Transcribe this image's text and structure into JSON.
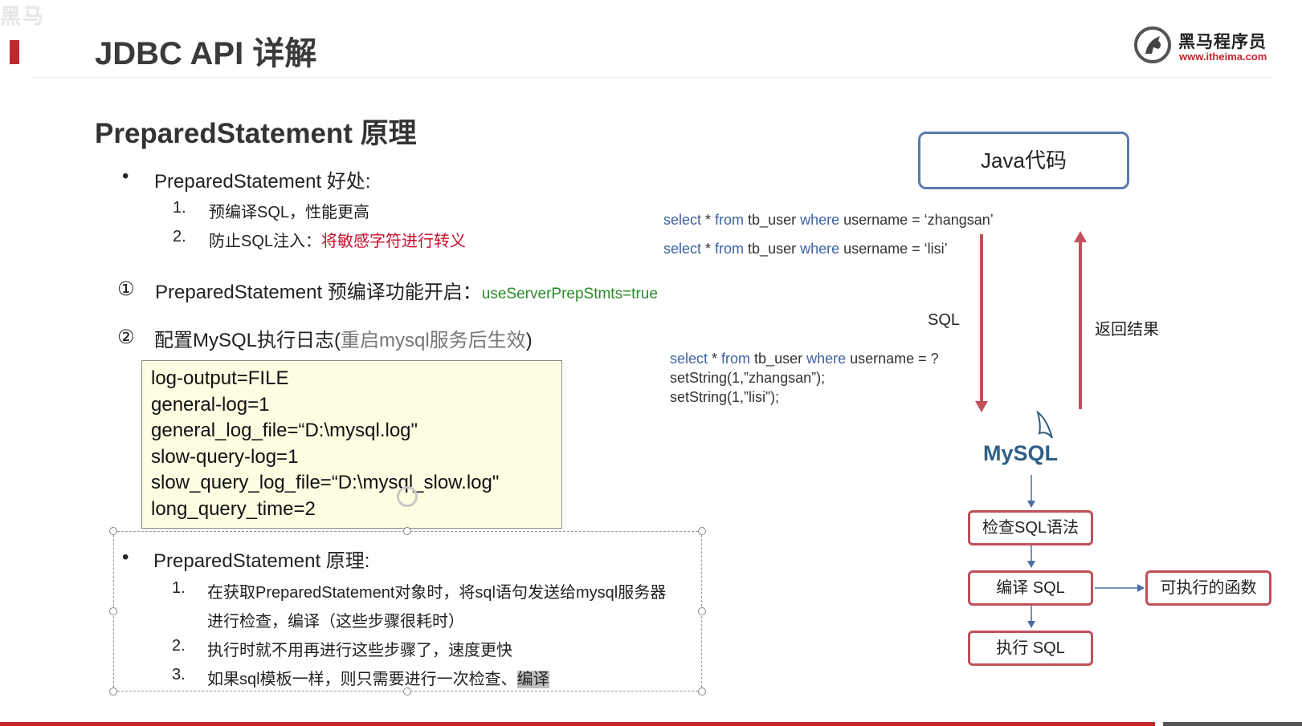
{
  "header": {
    "corner_watermark": "黑马",
    "title": "JDBC API 详解",
    "logo": {
      "name": "黑马程序员",
      "url": "www.itheima.com",
      "icon": "horse-head-logo"
    }
  },
  "section": {
    "title": "PreparedStatement 原理",
    "benefits": {
      "bullet": "PreparedStatement 好处:",
      "items": [
        {
          "num": "1.",
          "text": "预编译SQL，性能更高"
        },
        {
          "num": "2.",
          "text": "防止SQL注入：",
          "highlight": "将敏感字符进行转义"
        }
      ]
    },
    "step1": {
      "marker": "①",
      "text": "PreparedStatement 预编译功能开启：",
      "value": "useServerPrepStmts=true"
    },
    "step2": {
      "marker": "②",
      "text": "配置MySQL执行日志(",
      "note": "重启mysql服务后生效",
      "close": ")"
    },
    "config_lines": [
      "log-output=FILE",
      "general-log=1",
      "general_log_file=“D:\\mysql.log\"",
      "slow-query-log=1",
      "slow_query_log_file=“D:\\mysql_slow.log\"",
      "long_query_time=2"
    ],
    "principle": {
      "bullet": "PreparedStatement 原理:",
      "items": [
        {
          "num": "1.",
          "line1": "在获取PreparedStatement对象时，将sql语句发送给mysql服务器",
          "line2": "进行检查，编译（这些步骤很耗时）"
        },
        {
          "num": "2.",
          "line1": "执行时就不用再进行这些步骤了，速度更快"
        },
        {
          "num": "3.",
          "line1": "如果sql模板一样，则只需要进行一次检查、",
          "highlight": "编译"
        }
      ]
    }
  },
  "diagram": {
    "java_box": "Java代码",
    "query1": {
      "kw1": "select",
      "mid1": " * ",
      "kw2": "from",
      "mid2": " tb_user ",
      "kw3": "where",
      "rest": " username = ‘zhangsan’"
    },
    "query2": {
      "kw1": "select",
      "mid1": " * ",
      "kw2": "from",
      "mid2": " tb_user ",
      "kw3": "where",
      "rest": " username = ‘lisi’"
    },
    "prepared": {
      "kw1": "select",
      "mid1": " * ",
      "kw2": "from",
      "mid2": " tb_user ",
      "kw3": "where",
      "rest": " username = ?",
      "set1": "setString(1,”zhangsan”);",
      "set2": "setString(1,”lisi”);"
    },
    "sql_label": "SQL",
    "return_label": "返回结果",
    "mysql_logo": "MySQL",
    "steps": [
      "检查SQL语法",
      "编译 SQL",
      "执行 SQL"
    ],
    "output": "可执行的函数",
    "colors": {
      "arrow_red": "#c0505a",
      "arrow_blue": "#4a6ea8",
      "java_border": "#5a7bb0"
    }
  }
}
